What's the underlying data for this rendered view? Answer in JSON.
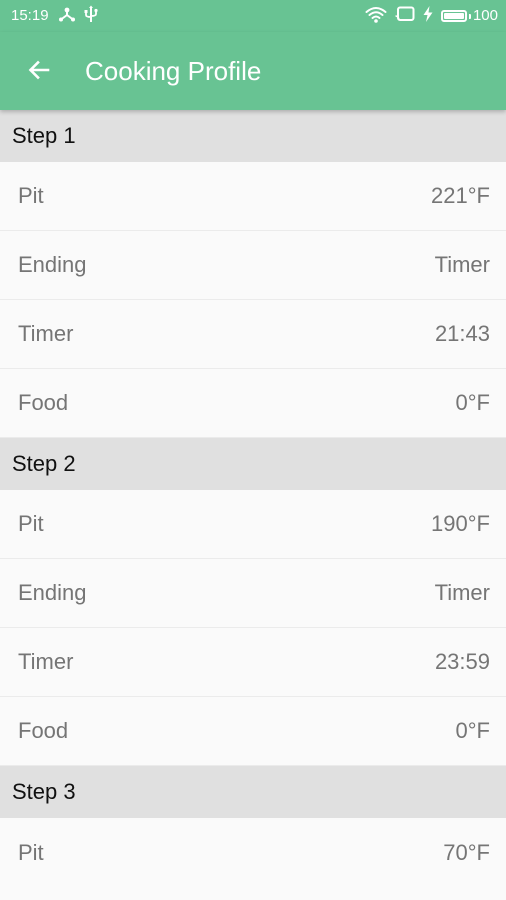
{
  "status_bar": {
    "time": "15:19",
    "battery_level": "100",
    "battery_fraction": 1.0,
    "left_icons": [
      "usb-connection-icon",
      "usb-debug-icon"
    ],
    "right_icons": [
      "wifi-icon",
      "cast-icon",
      "charging-bolt-icon",
      "battery-icon"
    ]
  },
  "app_bar": {
    "title": "Cooking Profile",
    "back_icon": "arrow-left-icon",
    "background_color": "#68c393"
  },
  "steps": [
    {
      "label": "Step 1",
      "rows": [
        {
          "label": "Pit",
          "value": "221°F"
        },
        {
          "label": "Ending",
          "value": "Timer"
        },
        {
          "label": "Timer",
          "value": "21:43"
        },
        {
          "label": "Food",
          "value": "0°F"
        }
      ]
    },
    {
      "label": "Step 2",
      "rows": [
        {
          "label": "Pit",
          "value": "190°F"
        },
        {
          "label": "Ending",
          "value": "Timer"
        },
        {
          "label": "Timer",
          "value": "23:59"
        },
        {
          "label": "Food",
          "value": "0°F"
        }
      ]
    },
    {
      "label": "Step 3",
      "rows": [
        {
          "label": "Pit",
          "value": "70°F"
        }
      ]
    }
  ]
}
